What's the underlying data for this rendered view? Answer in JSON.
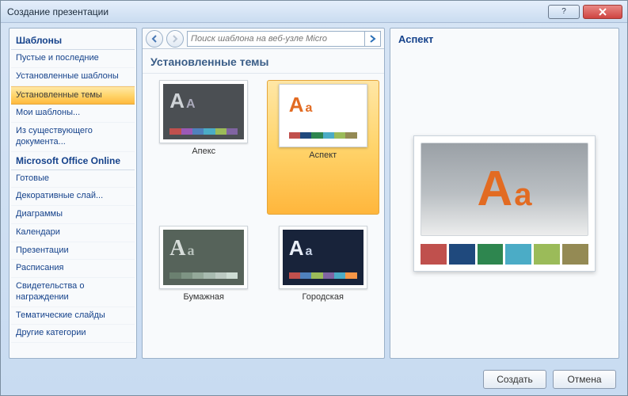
{
  "window": {
    "title": "Создание презентации"
  },
  "sidebar": {
    "header1": "Шаблоны",
    "items1": [
      "Пустые и последние",
      "Установленные шаблоны",
      "Установленные темы",
      "Мои шаблоны...",
      "Из существующего документа..."
    ],
    "selected1": 2,
    "header2": "Microsoft Office Online",
    "items2": [
      "Готовые",
      "Декоративные слай...",
      "Диаграммы",
      "Календари",
      "Презентации",
      "Расписания",
      "Свидетельства о награждении",
      "Тематические слайды",
      "Другие категории"
    ]
  },
  "search": {
    "placeholder": "Поиск шаблона на веб-узле Micro"
  },
  "themes": {
    "title": "Установленные темы",
    "items": [
      {
        "label": "Апекс"
      },
      {
        "label": "Аспект"
      },
      {
        "label": "Бумажная"
      },
      {
        "label": "Городская"
      }
    ],
    "selected": 1
  },
  "preview": {
    "title": "Аспект"
  },
  "footer": {
    "create": "Создать",
    "cancel": "Отмена"
  }
}
